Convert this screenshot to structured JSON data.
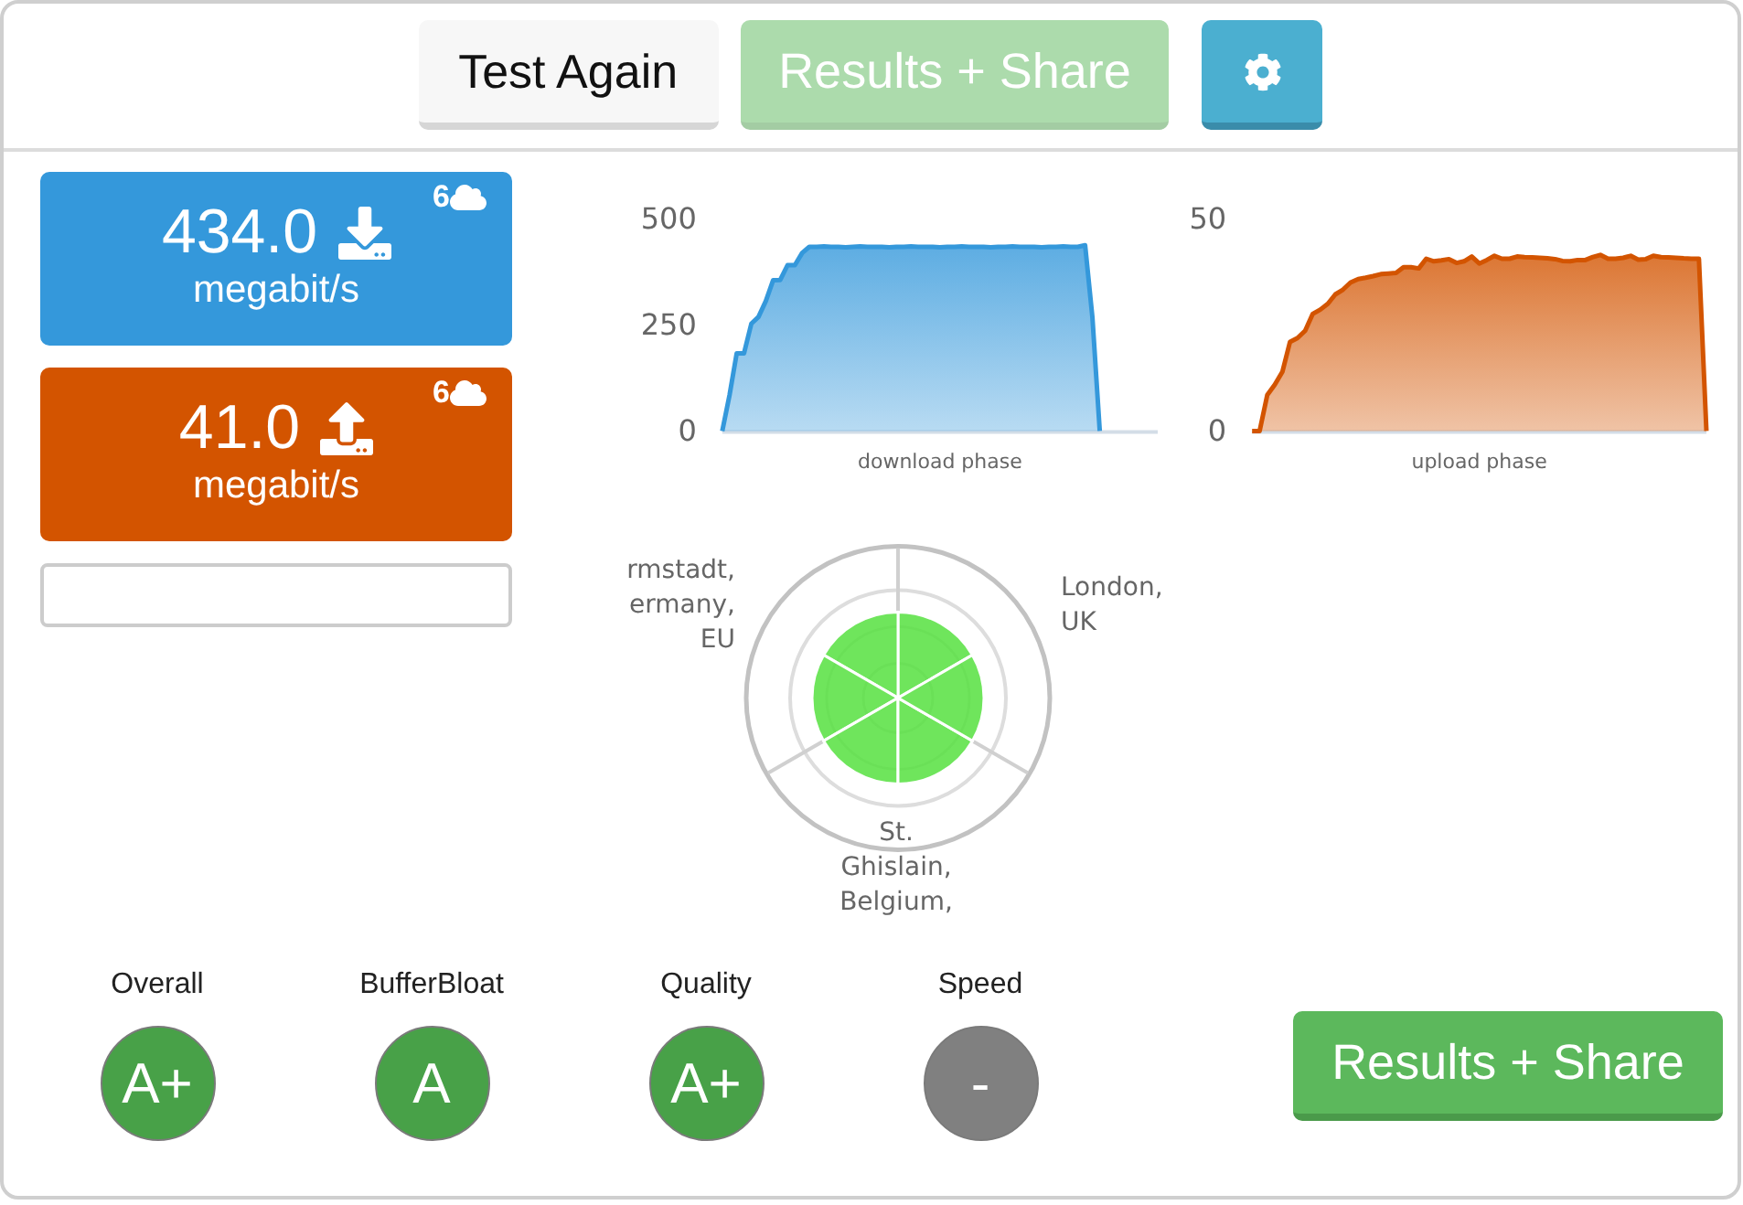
{
  "toolbar": {
    "buttons": [
      {
        "kind": "default",
        "label": "Test Again"
      },
      {
        "kind": "share",
        "label": "Results + Share",
        "disabled": true
      },
      {
        "kind": "settings"
      }
    ]
  },
  "speed_cards": [
    {
      "kind": "download",
      "value": "434.0",
      "unit": "megabit/s",
      "streams": "6"
    },
    {
      "kind": "upload",
      "value": "41.0",
      "unit": "megabit/s",
      "streams": "6"
    }
  ],
  "charts": [
    {
      "chart_data": {
        "type": "area",
        "xlabel": "download phase",
        "categories": [
          null,
          null,
          null,
          null,
          null,
          null,
          null,
          null,
          null,
          null,
          null,
          null,
          null,
          null,
          null,
          null,
          null,
          null,
          null,
          null,
          null,
          null,
          null,
          null,
          null,
          null,
          null,
          null,
          null,
          null,
          null,
          null,
          null,
          null,
          null,
          null,
          null,
          null,
          null,
          null,
          null,
          null,
          null,
          null,
          null,
          null,
          null,
          null,
          null,
          null,
          null,
          null,
          null,
          null,
          null,
          null,
          null,
          null,
          null,
          null,
          null
        ],
        "series": [
          {
            "color": "#3498db",
            "values": [
              0,
              85,
              183,
              183,
              253,
              269,
              306,
              355,
              356,
              391,
              391,
              420,
              434,
              434,
              435,
              434,
              434,
              433,
              434,
              435,
              434,
              434,
              434,
              433,
              434,
              434,
              435,
              434,
              434,
              434,
              433,
              434,
              434,
              435,
              434,
              434,
              434,
              433,
              434,
              434,
              435,
              434,
              434,
              434,
              433,
              434,
              434,
              435,
              434,
              434,
              438,
              267,
              0,
              null,
              null,
              null,
              null,
              null,
              null,
              null,
              null
            ]
          }
        ],
        "ylim": [
          0,
          500
        ],
        "yticks": [
          0,
          250,
          500
        ]
      }
    },
    {
      "chart_data": {
        "type": "area",
        "xlabel": "upload phase",
        "categories": [
          null,
          null,
          null,
          null,
          null,
          null,
          null,
          null,
          null,
          null,
          null,
          null,
          null,
          null,
          null,
          null,
          null,
          null,
          null,
          null,
          null,
          null,
          null,
          null,
          null,
          null,
          null,
          null,
          null,
          null,
          null,
          null,
          null,
          null,
          null,
          null,
          null,
          null,
          null,
          null,
          null,
          null,
          null,
          null,
          null,
          null,
          null,
          null,
          null,
          null,
          null,
          null,
          null,
          null,
          null,
          null,
          null,
          null,
          null,
          null,
          null
        ],
        "series": [
          {
            "color": "#d35400",
            "values": [
              0,
              0,
              8.5,
              10.9,
              14.0,
              21.0,
              21.9,
              23.6,
              27.6,
              28.6,
              30.0,
              32.2,
              33.3,
              35.0,
              35.8,
              36.1,
              36.5,
              37.0,
              37.1,
              37.3,
              38.6,
              38.6,
              38.3,
              40.6,
              40.0,
              40.2,
              40.5,
              39.6,
              40.0,
              41.1,
              39.5,
              40.3,
              41.3,
              40.6,
              40.6,
              41.1,
              41.0,
              40.9,
              40.8,
              40.7,
              40.5,
              40.1,
              40.0,
              40.3,
              40.3,
              41.0,
              41.5,
              40.6,
              40.6,
              40.8,
              41.3,
              40.4,
              40.5,
              41.3,
              41.0,
              40.9,
              40.8,
              40.7,
              40.6,
              40.6,
              0
            ]
          }
        ],
        "ylim": [
          0,
          50
        ],
        "yticks": [
          0,
          50
        ]
      }
    }
  ],
  "server_map": {
    "servers": [
      {
        "lines": [
          "rmstadt,",
          "ermany,",
          "EU"
        ]
      },
      {
        "lines": [
          "London,",
          "UK"
        ]
      },
      {
        "lines": [
          "St.",
          "Ghislain,",
          "Belgium,"
        ]
      }
    ]
  },
  "grades": [
    {
      "label": "Overall",
      "grade": "A+",
      "color": "#48a148"
    },
    {
      "label": "BufferBloat",
      "grade": "A",
      "color": "#48a148"
    },
    {
      "label": "Quality",
      "grade": "A+",
      "color": "#48a148"
    },
    {
      "label": "Speed",
      "grade": "-",
      "color": "#808080"
    }
  ],
  "share_button": {
    "label": "Results + Share",
    "disabled": false
  }
}
